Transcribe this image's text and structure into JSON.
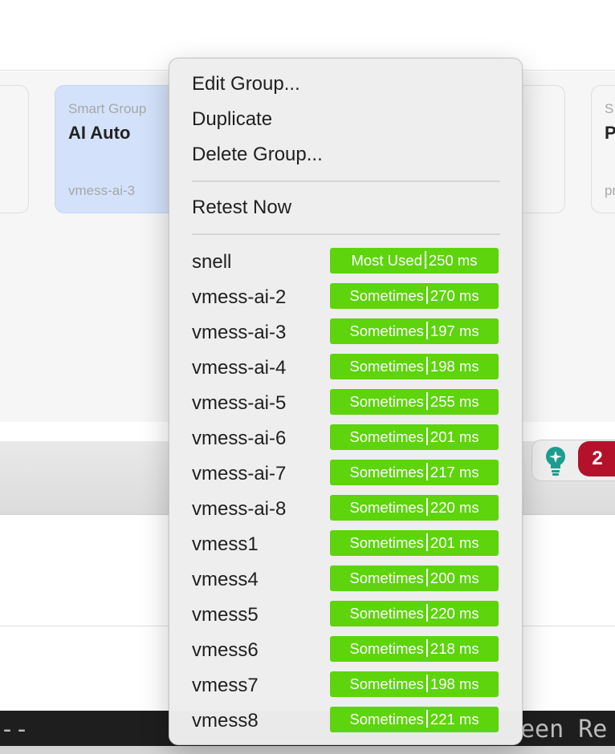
{
  "background": {
    "selected_card": {
      "kind": "Smart Group",
      "name": "AI Auto",
      "current": "vmess-ai-3"
    },
    "partial_cards": [
      {
        "kind": "S",
        "name": "P",
        "sub": "pr"
      }
    ],
    "extension_badge_count": "2",
    "terminal_left": "--",
    "terminal_right": "een Re"
  },
  "menu": {
    "actions": [
      "Edit Group...",
      "Duplicate",
      "Delete Group..."
    ],
    "retest": "Retest Now",
    "proxies": [
      {
        "name": "snell",
        "usage": "Most Used",
        "latency": "250 ms"
      },
      {
        "name": "vmess-ai-2",
        "usage": "Sometimes",
        "latency": "270 ms"
      },
      {
        "name": "vmess-ai-3",
        "usage": "Sometimes",
        "latency": "197 ms"
      },
      {
        "name": "vmess-ai-4",
        "usage": "Sometimes",
        "latency": "198 ms"
      },
      {
        "name": "vmess-ai-5",
        "usage": "Sometimes",
        "latency": "255 ms"
      },
      {
        "name": "vmess-ai-6",
        "usage": "Sometimes",
        "latency": "201 ms"
      },
      {
        "name": "vmess-ai-7",
        "usage": "Sometimes",
        "latency": "217 ms"
      },
      {
        "name": "vmess-ai-8",
        "usage": "Sometimes",
        "latency": "220 ms"
      },
      {
        "name": "vmess1",
        "usage": "Sometimes",
        "latency": "201 ms"
      },
      {
        "name": "vmess4",
        "usage": "Sometimes",
        "latency": "200 ms"
      },
      {
        "name": "vmess5",
        "usage": "Sometimes",
        "latency": "220 ms"
      },
      {
        "name": "vmess6",
        "usage": "Sometimes",
        "latency": "218 ms"
      },
      {
        "name": "vmess7",
        "usage": "Sometimes",
        "latency": "198 ms"
      },
      {
        "name": "vmess8",
        "usage": "Sometimes",
        "latency": "221 ms"
      }
    ]
  },
  "colors": {
    "badge_green": "#5dd40c",
    "selected_card": "#d3e2fa",
    "notification_red": "#b3122a"
  }
}
